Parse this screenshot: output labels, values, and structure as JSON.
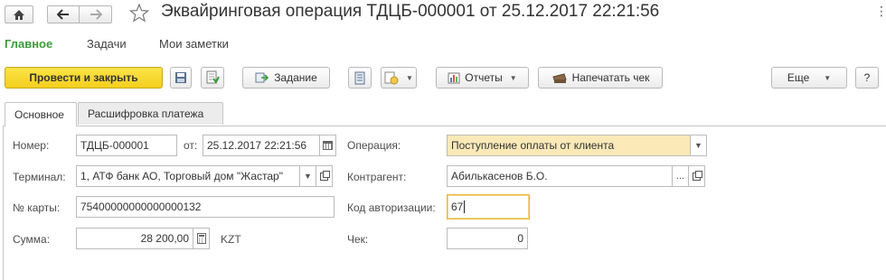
{
  "window": {
    "title": "Эквайринговая операция ТДЦБ-000001 от 25.12.2017 22:21:56",
    "more_icon": "vertical-dots-icon"
  },
  "sections": [
    {
      "label": "Главное",
      "active": true
    },
    {
      "label": "Задачи",
      "active": false
    },
    {
      "label": "Мои заметки",
      "active": false
    }
  ],
  "toolbar": {
    "post_close": "Провести и закрыть",
    "task": "Задание",
    "reports": "Отчеты",
    "print_receipt": "Напечатать чек",
    "more": "Еще",
    "help": "?"
  },
  "tabs": [
    {
      "label": "Основное",
      "active": true
    },
    {
      "label": "Расшифровка платежа",
      "active": false
    }
  ],
  "form": {
    "number": {
      "label": "Номер:",
      "value": "ТДЦБ-000001"
    },
    "date": {
      "label": "от:",
      "value": "25.12.2017 22:21:56"
    },
    "operation": {
      "label": "Операция:",
      "value": "Поступление оплаты от клиента"
    },
    "terminal": {
      "label": "Терминал:",
      "value": "1, АТФ банк АО, Торговый дом \"Жастар\""
    },
    "counterparty": {
      "label": "Контрагент:",
      "value": "Абилькасенов Б.О."
    },
    "card": {
      "label": "№ карты:",
      "value": "75400000000000000132"
    },
    "auth_code": {
      "label": "Код авторизации:",
      "value": "67"
    },
    "sum": {
      "label": "Сумма:",
      "value": "28 200,00",
      "currency": "KZT"
    },
    "receipt": {
      "label": "Чек:",
      "value": "0"
    }
  },
  "colors": {
    "accent_green": "#3a9c3a",
    "primary_button": "#f4cf1e",
    "highlight_field": "#fbe9b8",
    "focus_border": "#e9b83b"
  }
}
